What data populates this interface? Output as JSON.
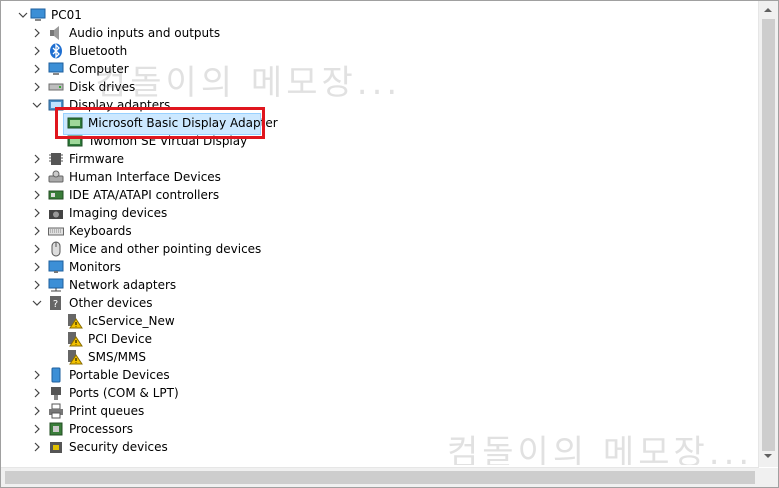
{
  "tree": {
    "root": "PC01",
    "categories": [
      {
        "label": "Audio inputs and outputs",
        "icon": "speaker-icon"
      },
      {
        "label": "Bluetooth",
        "icon": "bluetooth-icon"
      },
      {
        "label": "Computer",
        "icon": "computer-icon"
      },
      {
        "label": "Disk drives",
        "icon": "disk-drive-icon"
      },
      {
        "label": "Display adapters",
        "icon": "display-adapter-icon"
      },
      {
        "label": "Microsoft Basic Display Adapter",
        "icon": "display-adapter-icon"
      },
      {
        "label": "Twomon SE Virtual Display",
        "icon": "display-adapter-icon"
      },
      {
        "label": "Firmware",
        "icon": "firmware-icon"
      },
      {
        "label": "Human Interface Devices",
        "icon": "hid-icon"
      },
      {
        "label": "IDE ATA/ATAPI controllers",
        "icon": "ide-controller-icon"
      },
      {
        "label": "Imaging devices",
        "icon": "camera-icon"
      },
      {
        "label": "Keyboards",
        "icon": "keyboard-icon"
      },
      {
        "label": "Mice and other pointing devices",
        "icon": "mouse-icon"
      },
      {
        "label": "Monitors",
        "icon": "monitor-icon"
      },
      {
        "label": "Network adapters",
        "icon": "network-adapter-icon"
      },
      {
        "label": "Other devices",
        "icon": "other-devices-icon"
      },
      {
        "label": "IcService_New",
        "icon": "unknown-device-warning-icon"
      },
      {
        "label": "PCI Device",
        "icon": "unknown-device-warning-icon"
      },
      {
        "label": "SMS/MMS",
        "icon": "unknown-device-warning-icon"
      },
      {
        "label": "Portable Devices",
        "icon": "portable-device-icon"
      },
      {
        "label": "Ports (COM & LPT)",
        "icon": "port-icon"
      },
      {
        "label": "Print queues",
        "icon": "printer-icon"
      },
      {
        "label": "Processors",
        "icon": "processor-icon"
      },
      {
        "label": "Security devices",
        "icon": "security-device-icon"
      }
    ]
  },
  "watermark": {
    "text": "컴돌이의 메모장..."
  },
  "highlight_color": "#e0161e",
  "selection_color": "#cce8ff"
}
